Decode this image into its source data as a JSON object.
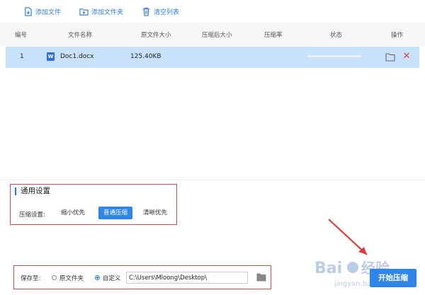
{
  "toolbar": {
    "add_file": "添加文件",
    "add_folder": "添加文件夹",
    "clear_list": "清空列表"
  },
  "table": {
    "headers": [
      "编号",
      "文件名称",
      "原文件大小",
      "压缩后大小",
      "压缩率",
      "状态",
      "操作"
    ],
    "rows": [
      {
        "index": "1",
        "name": "Doc1.docx",
        "original_size": "125.40KB",
        "compressed_size": "",
        "ratio": "",
        "progress": 0
      }
    ]
  },
  "settings": {
    "title": "通用设置",
    "label": "压缩设置:",
    "options": [
      "缩小优先",
      "普通压缩",
      "清晰优先"
    ],
    "selected": "普通压缩"
  },
  "save": {
    "label": "保存至:",
    "option_original": "原文件夹",
    "option_custom": "自定义",
    "selected": "自定义",
    "path": "C:\\Users\\Mloong\\Desktop\\"
  },
  "start_button": "开始压缩",
  "colors": {
    "accent": "#2f86e6",
    "selected_row": "#c9e2fb",
    "highlight_box": "#e04848",
    "delete": "#e03a3a"
  },
  "watermark": {
    "text_a": "Bai",
    "text_b": "经验",
    "sub": "jingyan.baidu.com"
  }
}
